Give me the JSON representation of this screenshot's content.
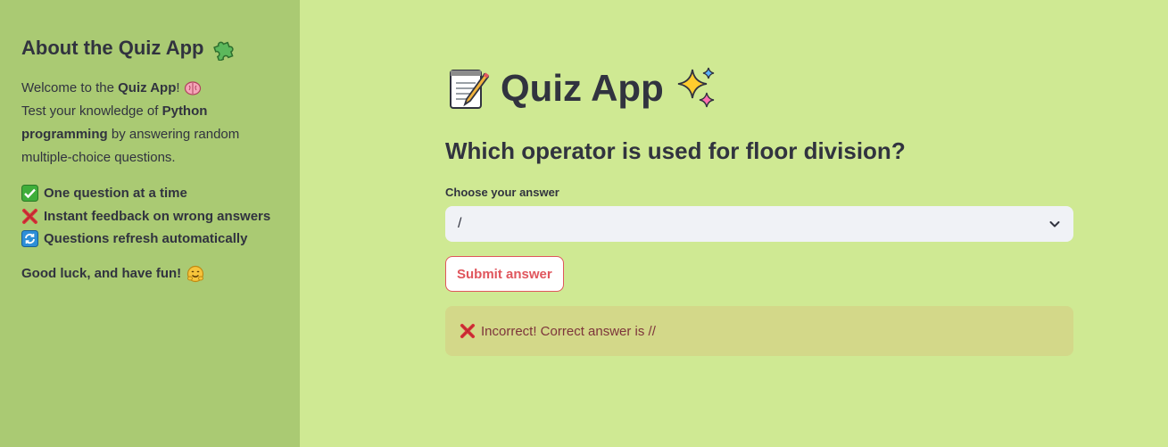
{
  "sidebar": {
    "title": "About the Quiz App",
    "title_icon": "puzzle-icon",
    "welcome_prefix": "Welcome to the ",
    "welcome_bold": "Quiz App",
    "welcome_suffix": "!",
    "welcome_icon": "brain-icon",
    "test_prefix": "Test your knowledge of ",
    "test_bold": "Python programming",
    "test_suffix": " by answering random multiple-choice questions.",
    "features": [
      {
        "icon": "check-mark-icon",
        "label": "One question at a time"
      },
      {
        "icon": "cross-mark-icon",
        "label": "Instant feedback on wrong answers"
      },
      {
        "icon": "refresh-icon",
        "label": "Questions refresh automatically"
      }
    ],
    "goodluck": "Good luck, and have fun!",
    "goodluck_icon": "hugging-face-icon"
  },
  "main": {
    "title": "Quiz App",
    "title_icons": [
      "memo-icon",
      "sparkles-icon"
    ],
    "question": "Which operator is used for floor division?",
    "select_label": "Choose your answer",
    "selected_answer": "/",
    "submit_label": "Submit answer",
    "feedback": "Incorrect! Correct answer is //",
    "feedback_icon": "cross-mark-icon"
  },
  "colors": {
    "main_bg": "#cfe993",
    "sidebar_bg": "#aaca73",
    "accent": "#e0565d",
    "alert_bg": "#d3d889",
    "alert_text": "#7d353b"
  }
}
